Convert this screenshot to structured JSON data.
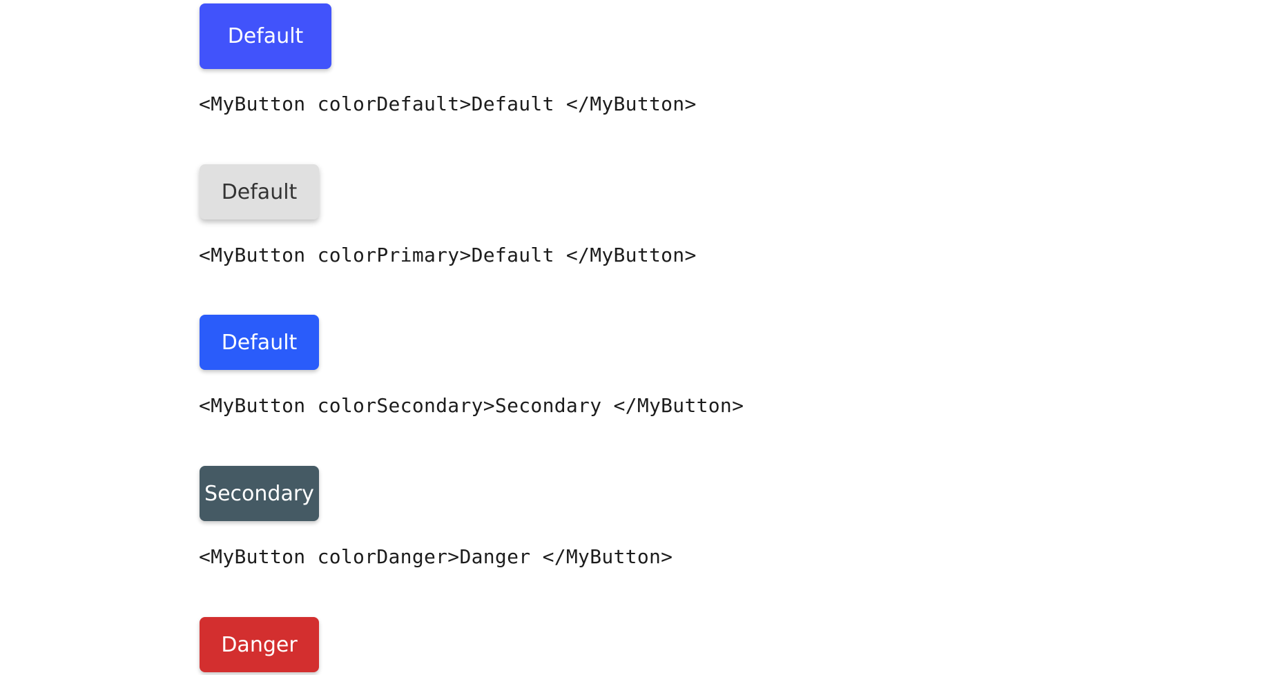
{
  "colors": {
    "default_bg": "#4153fb",
    "default_fg": "#ffffff",
    "primary_bg": "#e0e0e0",
    "primary_fg": "#333333",
    "secondary_blue_bg": "#2a5cfa",
    "secondary_blue_fg": "#ffffff",
    "secondary_bg": "#455a64",
    "secondary_fg": "#ffffff",
    "danger_bg": "#d32f2f",
    "danger_fg": "#ffffff"
  },
  "examples": [
    {
      "button_label": "Default",
      "code": "<MyButton colorDefault>Default </MyButton>"
    },
    {
      "button_label": "Default",
      "code": "<MyButton colorPrimary>Default </MyButton>"
    },
    {
      "button_label": "Default",
      "code": "<MyButton colorSecondary>Secondary </MyButton>"
    },
    {
      "button_label": "Secondary",
      "code": "<MyButton colorDanger>Danger </MyButton>"
    },
    {
      "button_label": "Danger"
    }
  ]
}
